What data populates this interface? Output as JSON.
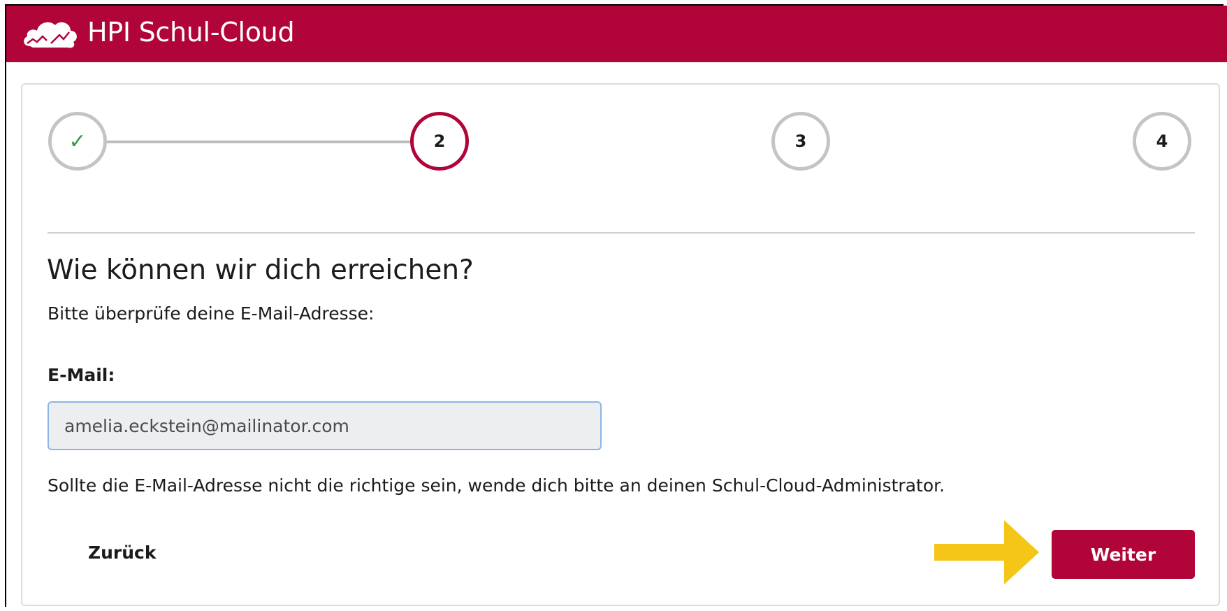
{
  "header": {
    "app_title": "HPI Schul-Cloud",
    "brand_color": "#b10438"
  },
  "stepper": {
    "steps": [
      {
        "label": "✓",
        "state": "done"
      },
      {
        "label": "2",
        "state": "active"
      },
      {
        "label": "3",
        "state": "pending"
      },
      {
        "label": "4",
        "state": "pending"
      }
    ],
    "active_color": "#b10438",
    "done_color": "#2e9e3e"
  },
  "main": {
    "heading": "Wie können wir dich erreichen?",
    "subtext": "Bitte überprüfe deine E-Mail-Adresse:",
    "email_label": "E-Mail:",
    "email_value": "amelia.eckstein@mailinator.com",
    "note": "Sollte die E-Mail-Adresse nicht die richtige sein, wende dich bitte an deinen Schul-Cloud-Administrator."
  },
  "actions": {
    "back_label": "Zurück",
    "next_label": "Weiter"
  },
  "annotation": {
    "icon": "arrow-right-icon",
    "color": "#f5c518"
  }
}
